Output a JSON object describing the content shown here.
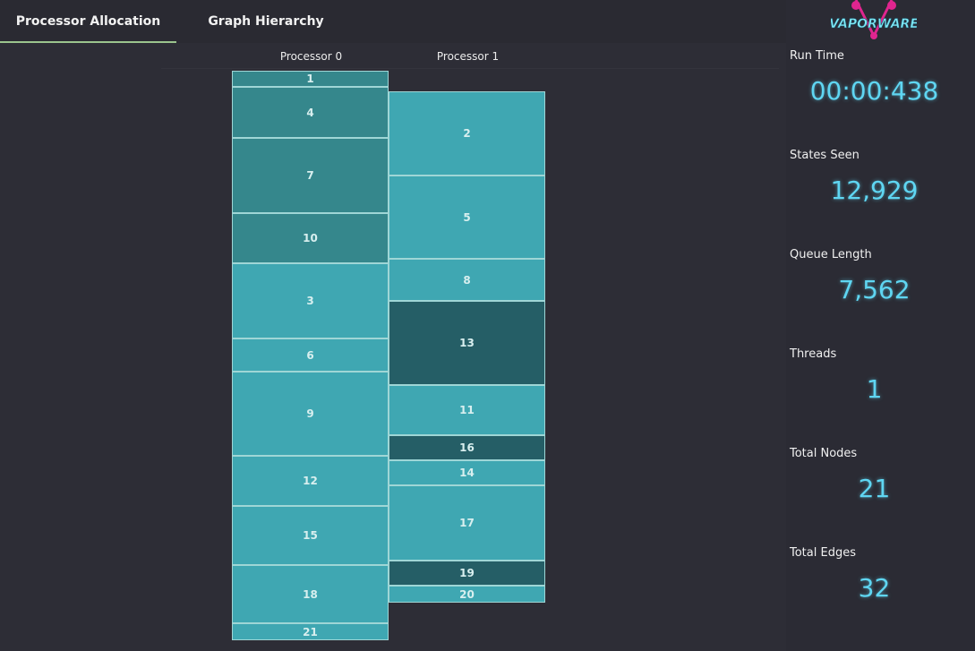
{
  "tabs": [
    {
      "label": "Processor Allocation",
      "active": true
    },
    {
      "label": "Graph Hierarchy",
      "active": false
    }
  ],
  "processors": [
    {
      "label": "Processor 0",
      "tasks": [
        {
          "id": "1",
          "start": 0,
          "end": 18
        },
        {
          "id": "4",
          "start": 18,
          "end": 75
        },
        {
          "id": "7",
          "start": 75,
          "end": 159
        },
        {
          "id": "10",
          "start": 159,
          "end": 215
        },
        {
          "id": "3",
          "start": 215,
          "end": 299
        },
        {
          "id": "6",
          "start": 299,
          "end": 336
        },
        {
          "id": "9",
          "start": 336,
          "end": 430
        },
        {
          "id": "12",
          "start": 430,
          "end": 486
        },
        {
          "id": "15",
          "start": 486,
          "end": 552
        },
        {
          "id": "18",
          "start": 552,
          "end": 617
        },
        {
          "id": "21",
          "start": 617,
          "end": 636
        }
      ]
    },
    {
      "label": "Processor 1",
      "tasks": [
        {
          "id": "2",
          "start": 23,
          "end": 117
        },
        {
          "id": "5",
          "start": 117,
          "end": 210
        },
        {
          "id": "8",
          "start": 210,
          "end": 257
        },
        {
          "id": "13",
          "start": 257,
          "end": 351
        },
        {
          "id": "11",
          "start": 351,
          "end": 407
        },
        {
          "id": "16",
          "start": 407,
          "end": 435
        },
        {
          "id": "14",
          "start": 435,
          "end": 463
        },
        {
          "id": "17",
          "start": 463,
          "end": 547
        },
        {
          "id": "19",
          "start": 547,
          "end": 575
        },
        {
          "id": "20",
          "start": 575,
          "end": 594
        }
      ]
    }
  ],
  "colors": {
    "teal_light": "#3fa7b2",
    "teal_mid": "#35878c",
    "teal_dark": "#255e66",
    "stat_value": "#5fd6f2",
    "tab_underline": "#9bc48e",
    "logo_pink": "#e0258f"
  },
  "logo": {
    "text": "VAPORWARE"
  },
  "stats": [
    {
      "label": "Run Time",
      "value": "00:00:438"
    },
    {
      "label": "States Seen",
      "value": "12,929"
    },
    {
      "label": "Queue Length",
      "value": "7,562"
    },
    {
      "label": "Threads",
      "value": "1"
    },
    {
      "label": "Total Nodes",
      "value": "21"
    },
    {
      "label": "Total Edges",
      "value": "32"
    }
  ]
}
